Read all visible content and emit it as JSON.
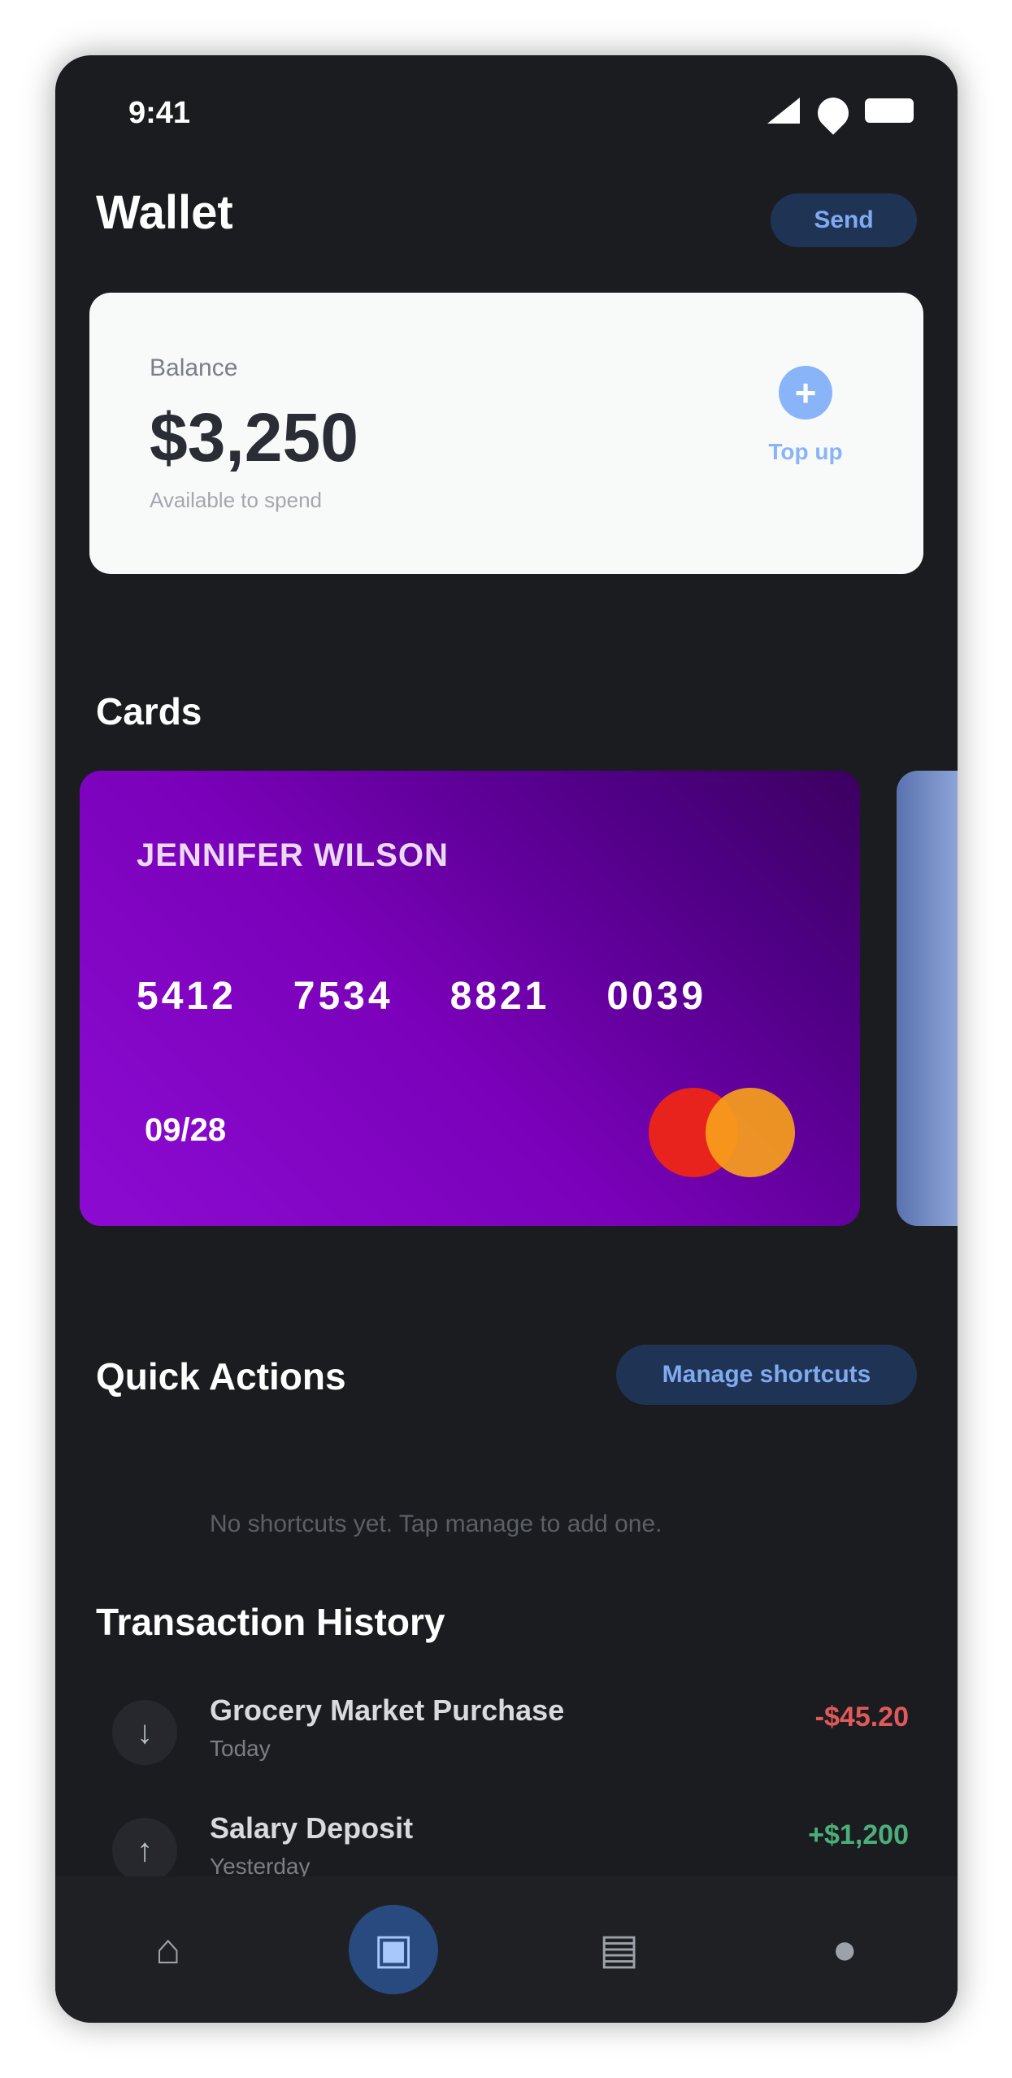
{
  "status_bar": {
    "time": "9:41"
  },
  "header": {
    "title": "Wallet",
    "action_label": "Send"
  },
  "balance": {
    "label": "Balance",
    "amount": "$3,250",
    "sub": "Available to spend",
    "topup_label": "Top up",
    "topup_icon": "+"
  },
  "cards_section": {
    "title": "Cards"
  },
  "card": {
    "holder": "JENNIFER WILSON",
    "number_groups": [
      "5412",
      "7534",
      "8821",
      "0039"
    ],
    "expiry": "09/28",
    "brand": "mastercard",
    "gradient": [
      "#8c0bd2",
      "#3c0060"
    ]
  },
  "quick_actions": {
    "title": "Quick Actions",
    "link_label": "Manage shortcuts",
    "empty_note": "No shortcuts yet. Tap manage to add one."
  },
  "transactions": {
    "title": "Transaction History",
    "items": [
      {
        "icon": "↓",
        "name": "Grocery Market Purchase",
        "date": "Today",
        "amount": "-$45.20",
        "color": "#e05a5a"
      },
      {
        "icon": "↑",
        "name": "Salary Deposit",
        "date": "Yesterday",
        "amount": "+$1,200",
        "color": "#4caf7a"
      }
    ]
  },
  "bottom_nav": {
    "items": [
      {
        "icon": "home-icon",
        "glyph": "⌂"
      },
      {
        "icon": "wallet-icon",
        "glyph": "▣"
      },
      {
        "icon": "chart-icon",
        "glyph": "▤"
      },
      {
        "icon": "profile-icon",
        "glyph": "●"
      }
    ],
    "active_index": 1
  },
  "colors": {
    "background": "#1b1c20",
    "accent": "#8ab4f8",
    "card_primary": "#7a01b9"
  }
}
